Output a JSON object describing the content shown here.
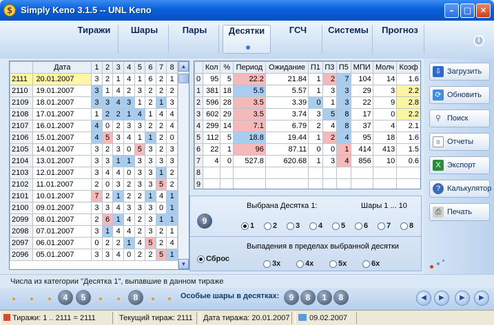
{
  "window": {
    "title": "Simply Keno 3.1.5   --   UNL Keno",
    "app_icon": "$"
  },
  "tabs": [
    "Тиражи",
    "Шары",
    "Пары",
    "Десятки",
    "ГСЧ",
    "Системы",
    "Прогноз"
  ],
  "active_tab": "Десятки",
  "draws": {
    "headers": [
      "",
      "Дата",
      "1",
      "2",
      "3",
      "4",
      "5",
      "6",
      "7",
      "8"
    ],
    "rows": [
      [
        "2111",
        "20.01.2007",
        "3",
        "2",
        "1",
        "4",
        "1",
        "6",
        "2",
        "1"
      ],
      [
        "2110",
        "19.01.2007",
        "3",
        "1",
        "4",
        "2",
        "3",
        "2",
        "2",
        "2"
      ],
      [
        "2109",
        "18.01.2007",
        "3",
        "3",
        "4",
        "3",
        "1",
        "2",
        "1",
        "3"
      ],
      [
        "2108",
        "17.01.2007",
        "1",
        "2",
        "2",
        "1",
        "4",
        "1",
        "4",
        "4"
      ],
      [
        "2107",
        "16.01.2007",
        "4",
        "0",
        "2",
        "3",
        "3",
        "2",
        "2",
        "4"
      ],
      [
        "2106",
        "15.01.2007",
        "4",
        "5",
        "3",
        "4",
        "1",
        "1",
        "2",
        "0"
      ],
      [
        "2105",
        "14.01.2007",
        "3",
        "2",
        "3",
        "0",
        "5",
        "3",
        "2",
        "3"
      ],
      [
        "2104",
        "13.01.2007",
        "3",
        "3",
        "1",
        "1",
        "3",
        "3",
        "3",
        "3"
      ],
      [
        "2103",
        "12.01.2007",
        "3",
        "4",
        "4",
        "0",
        "3",
        "3",
        "1",
        "2"
      ],
      [
        "2102",
        "11.01.2007",
        "2",
        "0",
        "3",
        "2",
        "3",
        "3",
        "5",
        "2"
      ],
      [
        "2101",
        "10.01.2007",
        "7",
        "2",
        "1",
        "2",
        "2",
        "1",
        "4",
        "1"
      ],
      [
        "2100",
        "09.01.2007",
        "3",
        "3",
        "4",
        "3",
        "3",
        "3",
        "0",
        "1"
      ],
      [
        "2099",
        "08.01.2007",
        "2",
        "6",
        "1",
        "4",
        "2",
        "3",
        "1",
        "1"
      ],
      [
        "2098",
        "07.01.2007",
        "3",
        "1",
        "4",
        "4",
        "2",
        "3",
        "2",
        "1"
      ],
      [
        "2097",
        "06.01.2007",
        "0",
        "2",
        "2",
        "1",
        "4",
        "5",
        "2",
        "4"
      ],
      [
        "2096",
        "05.01.2007",
        "3",
        "3",
        "4",
        "0",
        "2",
        "2",
        "5",
        "1"
      ]
    ],
    "cell_colors": [
      [
        "y",
        "y",
        "",
        "",
        "",
        "",
        "",
        "",
        "",
        "",
        "",
        ""
      ],
      [
        "",
        "",
        "b",
        "",
        "",
        "",
        "",
        "",
        "",
        ""
      ],
      [
        "",
        "",
        "b",
        "b",
        "b",
        "b",
        "",
        "",
        "b",
        ""
      ],
      [
        "",
        "",
        "",
        "b",
        "b",
        "b",
        "b",
        "",
        "",
        ""
      ],
      [
        "",
        "",
        "b",
        "",
        "",
        "",
        "",
        "",
        "",
        ""
      ],
      [
        "",
        "",
        "b",
        "p",
        "",
        "",
        "",
        "b",
        "",
        ""
      ],
      [
        "",
        "",
        "",
        "",
        "",
        "",
        "p",
        "",
        "",
        ""
      ],
      [
        "",
        "",
        "",
        "",
        "b",
        "b",
        "",
        "",
        "",
        ""
      ],
      [
        "",
        "",
        "",
        "",
        "",
        "",
        "",
        "",
        "b",
        ""
      ],
      [
        "",
        "",
        "",
        "",
        "",
        "",
        "",
        "",
        "p",
        ""
      ],
      [
        "",
        "",
        "p",
        "",
        "b",
        "",
        "",
        "b",
        "",
        "b"
      ],
      [
        "",
        "",
        "",
        "",
        "",
        "",
        "",
        "",
        "",
        "b"
      ],
      [
        "",
        "",
        "",
        "p",
        "b",
        "",
        "",
        "",
        "b",
        "b"
      ],
      [
        "",
        "",
        "",
        "b",
        "",
        "",
        "",
        "",
        "",
        ""
      ],
      [
        "",
        "",
        "",
        "",
        "",
        "b",
        "",
        "p",
        "",
        ""
      ],
      [
        "",
        "",
        "",
        "",
        "",
        "",
        "",
        "",
        "p",
        "b"
      ]
    ]
  },
  "tens": {
    "headers": [
      "",
      "Кол",
      "%",
      "Период",
      "Ожидание",
      "П1",
      "П3",
      "П5",
      "МПИ",
      "Молч",
      "Коэф"
    ],
    "rows": [
      [
        "0",
        "95",
        "5",
        "22.2",
        "21.84",
        "1",
        "2",
        "7",
        "104",
        "14",
        "1.6"
      ],
      [
        "1",
        "381",
        "18",
        "5.5",
        "5.57",
        "1",
        "3",
        "3",
        "29",
        "3",
        "2.2"
      ],
      [
        "2",
        "596",
        "28",
        "3.5",
        "3.39",
        "0",
        "1",
        "3",
        "22",
        "9",
        "2.8"
      ],
      [
        "3",
        "602",
        "29",
        "3.5",
        "3.74",
        "3",
        "5",
        "8",
        "17",
        "0",
        "2.2"
      ],
      [
        "4",
        "299",
        "14",
        "7.1",
        "6.79",
        "2",
        "4",
        "8",
        "37",
        "4",
        "2.1"
      ],
      [
        "5",
        "112",
        "5",
        "18.8",
        "19.44",
        "1",
        "2",
        "4",
        "95",
        "18",
        "1.6"
      ],
      [
        "6",
        "22",
        "1",
        "96",
        "87.11",
        "0",
        "0",
        "1",
        "414",
        "413",
        "1.5"
      ],
      [
        "7",
        "4",
        "0",
        "527.8",
        "620.68",
        "1",
        "3",
        "4",
        "856",
        "10",
        "0.6"
      ],
      [
        "8",
        "",
        "",
        "",
        "",
        "",
        "",
        "",
        "",
        "",
        ""
      ],
      [
        "9",
        "",
        "",
        "",
        "",
        "",
        "",
        "",
        "",
        "",
        ""
      ]
    ],
    "cell_colors": [
      [
        "",
        "",
        "",
        "p",
        "",
        "",
        "p",
        "b",
        "",
        "",
        ""
      ],
      [
        "",
        "",
        "",
        "b",
        "",
        "",
        "",
        "b",
        "",
        "",
        "y"
      ],
      [
        "",
        "",
        "",
        "p",
        "",
        "b",
        "",
        "b",
        "",
        "",
        "y"
      ],
      [
        "",
        "",
        "",
        "p",
        "",
        "",
        "b",
        "b",
        "",
        "",
        "y"
      ],
      [
        "",
        "",
        "",
        "p",
        "",
        "",
        "",
        "b",
        "",
        "",
        ""
      ],
      [
        "",
        "",
        "",
        "b",
        "",
        "",
        "p",
        "b",
        "",
        "",
        ""
      ],
      [
        "",
        "",
        "",
        "p",
        "",
        "",
        "",
        "p",
        "",
        "",
        ""
      ],
      [
        "",
        "",
        "",
        "",
        "",
        "",
        "",
        "p",
        "",
        "",
        ""
      ],
      [
        "",
        "",
        "",
        "",
        "",
        "",
        "",
        "",
        "",
        "",
        ""
      ],
      [
        "",
        "",
        "",
        "",
        "",
        "",
        "",
        "",
        "",
        "",
        ""
      ]
    ]
  },
  "selection": {
    "label": "Выбрана Десятка 1:",
    "range": "Шары 1 ... 10",
    "ball": "9",
    "radios": [
      "1",
      "2",
      "3",
      "4",
      "5",
      "6",
      "7",
      "8"
    ],
    "selected_radio": "1"
  },
  "drops": {
    "label": "Выпадения в пределах выбранной десятки",
    "reset": "Сброс",
    "options": [
      "3x",
      "4x",
      "5x",
      "6x"
    ]
  },
  "sidebar": [
    "Загрузить",
    "Обновить",
    "Поиск",
    "Отчеты",
    "Экспорт",
    "Калькулятор",
    "Печать"
  ],
  "info_text": "Числа из категории \"Десятка 1\", выпавшие в данном тираже",
  "balls": [
    "4",
    "5",
    "8"
  ],
  "special": {
    "label": "Особые шары в десятках:",
    "balls": [
      "9",
      "8",
      "1",
      "8"
    ]
  },
  "status": {
    "draws": "Тиражи: 1 .. 2111 = 2111",
    "current": "Текущий тираж: 2111",
    "date": "Дата тиража: 20.01.2007",
    "today": "09.02.2007"
  }
}
